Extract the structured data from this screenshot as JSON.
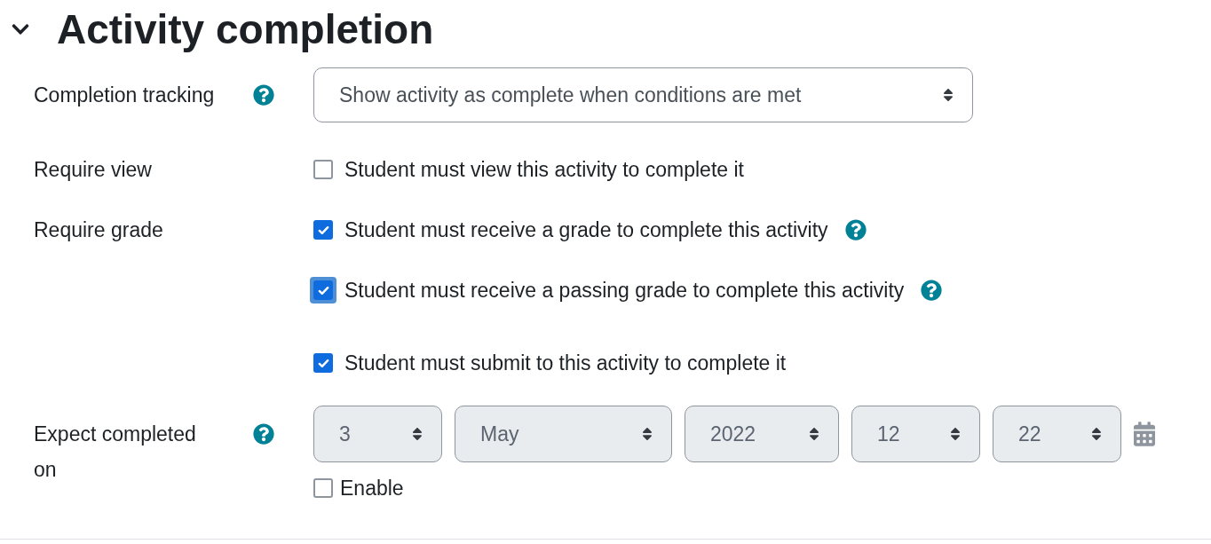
{
  "section": {
    "title": "Activity completion",
    "expanded": true
  },
  "fields": [
    {
      "kind": "select",
      "label": "Completion tracking",
      "help": true,
      "value": "Show activity as complete when conditions are met"
    },
    {
      "kind": "checkboxes",
      "label": "Require view",
      "help": false,
      "options": [
        {
          "text": "Student must view this activity to complete it",
          "checked": false,
          "focused": false,
          "help": false
        }
      ]
    },
    {
      "kind": "checkboxes",
      "label": "Require grade",
      "help": false,
      "options": [
        {
          "text": "Student must receive a grade to complete this activity",
          "checked": true,
          "focused": false,
          "help": true
        },
        {
          "text": "Student must receive a passing grade to complete this activity",
          "checked": true,
          "focused": true,
          "help": true
        },
        {
          "text": "Student must submit to this activity to complete it",
          "checked": true,
          "focused": false,
          "help": false
        }
      ]
    },
    {
      "kind": "date",
      "label": "Expect completed on",
      "help": true,
      "parts": [
        {
          "value": "3",
          "disabled": true
        },
        {
          "value": "May",
          "disabled": true
        },
        {
          "value": "2022",
          "disabled": true
        },
        {
          "value": "12",
          "disabled": true
        },
        {
          "value": "22",
          "disabled": true
        }
      ],
      "enable": {
        "text": "Enable",
        "checked": false
      }
    }
  ]
}
